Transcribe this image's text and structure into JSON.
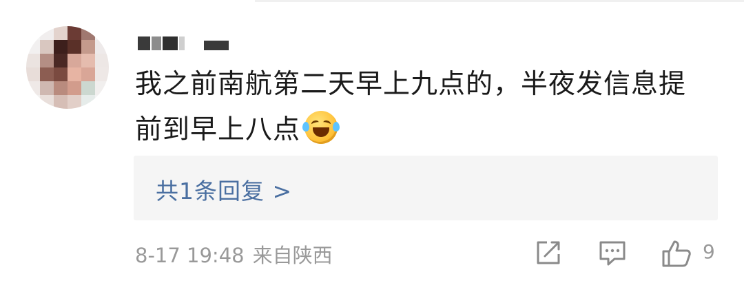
{
  "comment": {
    "author_display": "",
    "text_line1": "我之前南航第二天早上九点的，半夜发信息提",
    "text_line2": "前到早上八点",
    "emoji_name": "laugh-cry-emoji",
    "replies_link": "共1条回复 >",
    "date": "8-17 19:48",
    "location": "来自陕西",
    "like_count": "9"
  },
  "icons": {
    "share": "share-icon",
    "reply": "comment-icon",
    "like": "thumbs-up-icon"
  },
  "colors": {
    "text": "#1a1a1a",
    "link": "#4a6fa1",
    "meta": "#999999",
    "reply_bg": "#f5f5f5"
  }
}
